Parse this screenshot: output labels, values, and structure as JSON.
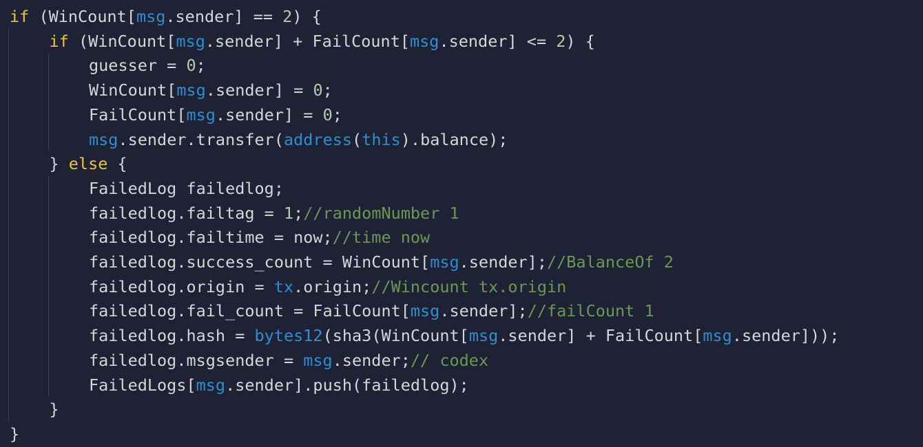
{
  "theme": {
    "background": "#1f2235",
    "text": "#d6d6d6",
    "keyword": "#ebc43c",
    "builtin": "#2d8fd1",
    "number": "#b5cea8",
    "comment": "#6a9955",
    "indent_guide": "#3b3f55"
  },
  "code_lines": [
    {
      "indent": 0,
      "tokens": [
        [
          "kw",
          "if"
        ],
        [
          "txt",
          " (WinCount["
        ],
        [
          "blue",
          "msg"
        ],
        [
          "txt",
          ".sender] == "
        ],
        [
          "num",
          "2"
        ],
        [
          "txt",
          ") {"
        ]
      ]
    },
    {
      "indent": 1,
      "tokens": [
        [
          "kw",
          "if"
        ],
        [
          "txt",
          " (WinCount["
        ],
        [
          "blue",
          "msg"
        ],
        [
          "txt",
          ".sender] + FailCount["
        ],
        [
          "blue",
          "msg"
        ],
        [
          "txt",
          ".sender] <= "
        ],
        [
          "num",
          "2"
        ],
        [
          "txt",
          ") {"
        ]
      ]
    },
    {
      "indent": 2,
      "tokens": [
        [
          "txt",
          "guesser = "
        ],
        [
          "num",
          "0"
        ],
        [
          "txt",
          ";"
        ]
      ]
    },
    {
      "indent": 2,
      "tokens": [
        [
          "txt",
          "WinCount["
        ],
        [
          "blue",
          "msg"
        ],
        [
          "txt",
          ".sender] = "
        ],
        [
          "num",
          "0"
        ],
        [
          "txt",
          ";"
        ]
      ]
    },
    {
      "indent": 2,
      "tokens": [
        [
          "txt",
          "FailCount["
        ],
        [
          "blue",
          "msg"
        ],
        [
          "txt",
          ".sender] = "
        ],
        [
          "num",
          "0"
        ],
        [
          "txt",
          ";"
        ]
      ]
    },
    {
      "indent": 2,
      "tokens": [
        [
          "blue",
          "msg"
        ],
        [
          "txt",
          ".sender.transfer("
        ],
        [
          "blue",
          "address"
        ],
        [
          "txt",
          "("
        ],
        [
          "blue",
          "this"
        ],
        [
          "txt",
          ").balance);"
        ]
      ]
    },
    {
      "indent": 1,
      "tokens": [
        [
          "txt",
          "} "
        ],
        [
          "kw",
          "else"
        ],
        [
          "txt",
          " {"
        ]
      ]
    },
    {
      "indent": 2,
      "tokens": [
        [
          "txt",
          "FailedLog failedlog;"
        ]
      ]
    },
    {
      "indent": 2,
      "tokens": [
        [
          "txt",
          "failedlog.failtag = "
        ],
        [
          "num",
          "1"
        ],
        [
          "txt",
          ";"
        ],
        [
          "com",
          "//randomNumber 1"
        ]
      ]
    },
    {
      "indent": 2,
      "tokens": [
        [
          "txt",
          "failedlog.failtime = now;"
        ],
        [
          "com",
          "//time now"
        ]
      ]
    },
    {
      "indent": 2,
      "tokens": [
        [
          "txt",
          "failedlog.success_count = WinCount["
        ],
        [
          "blue",
          "msg"
        ],
        [
          "txt",
          ".sender];"
        ],
        [
          "com",
          "//BalanceOf 2"
        ]
      ]
    },
    {
      "indent": 2,
      "tokens": [
        [
          "txt",
          "failedlog.origin = "
        ],
        [
          "blue",
          "tx"
        ],
        [
          "txt",
          ".origin;"
        ],
        [
          "com",
          "//Wincount tx.origin"
        ]
      ]
    },
    {
      "indent": 2,
      "tokens": [
        [
          "txt",
          "failedlog.fail_count = FailCount["
        ],
        [
          "blue",
          "msg"
        ],
        [
          "txt",
          ".sender];"
        ],
        [
          "com",
          "//failCount 1"
        ]
      ]
    },
    {
      "indent": 2,
      "tokens": [
        [
          "txt",
          "failedlog.hash = "
        ],
        [
          "blue",
          "bytes12"
        ],
        [
          "txt",
          "(sha3(WinCount["
        ],
        [
          "blue",
          "msg"
        ],
        [
          "txt",
          ".sender] + FailCount["
        ],
        [
          "blue",
          "msg"
        ],
        [
          "txt",
          ".sender]));"
        ]
      ]
    },
    {
      "indent": 2,
      "tokens": [
        [
          "txt",
          "failedlog.msgsender = "
        ],
        [
          "blue",
          "msg"
        ],
        [
          "txt",
          ".sender;"
        ],
        [
          "com",
          "// codex"
        ]
      ]
    },
    {
      "indent": 2,
      "tokens": [
        [
          "txt",
          "FailedLogs["
        ],
        [
          "blue",
          "msg"
        ],
        [
          "txt",
          ".sender].push(failedlog);"
        ]
      ]
    },
    {
      "indent": 1,
      "tokens": [
        [
          "txt",
          "}"
        ]
      ]
    },
    {
      "indent": 0,
      "tokens": [
        [
          "txt",
          "}"
        ]
      ]
    }
  ]
}
